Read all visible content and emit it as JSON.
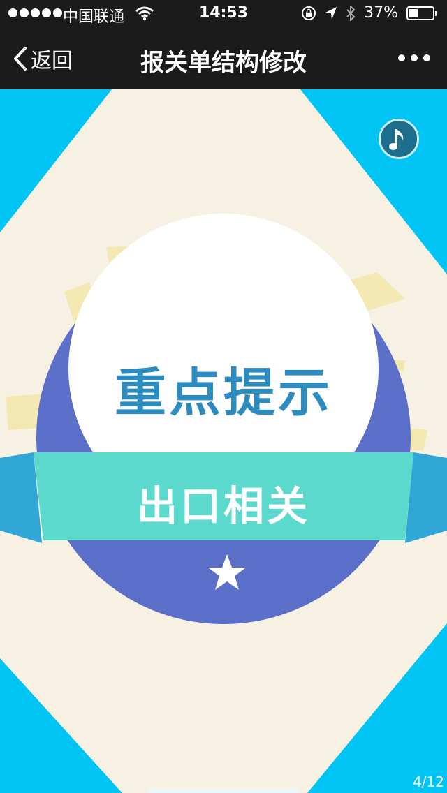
{
  "status_bar": {
    "carrier": "中国联通",
    "time": "14:53",
    "battery_text": "37%",
    "battery_level": 0.37
  },
  "nav": {
    "back_label": "返回",
    "title": "报关单结构修改"
  },
  "slide": {
    "title": "重点提示",
    "ribbon_text": "出口相关",
    "page_indicator": "4/12"
  },
  "colors": {
    "accent_cyan": "#00c4f4",
    "cream": "#f6f1e3",
    "badge_blue": "#5b6fc9",
    "ribbon_teal": "#5bd9cc",
    "ribbon_tail": "#2fa6d6",
    "title_blue": "#2c8cc0"
  },
  "icons": {
    "back": "chevron-left-icon",
    "more": "more-dots-icon",
    "music": "music-note-icon",
    "star": "star-icon",
    "wifi": "wifi-icon",
    "location": "location-arrow-icon",
    "bluetooth": "bluetooth-icon",
    "rotation_lock": "rotation-lock-icon"
  }
}
